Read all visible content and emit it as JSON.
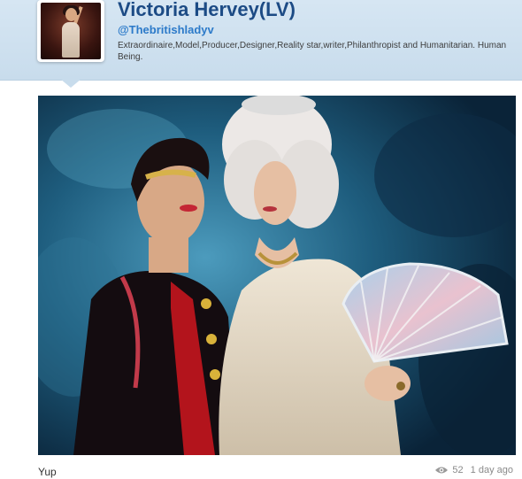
{
  "profile": {
    "name": "Victoria Hervey(LV)",
    "handle": "@Thebritishladyv",
    "bio": "Extraordinaire,Model,Producer,Designer,Reality star,writer,Philanthropist and Humanitarian. Human Being."
  },
  "post": {
    "caption": "Yup",
    "views": "52",
    "time_ago": "1 day ago"
  },
  "icons": {
    "views": "eye-icon"
  },
  "colors": {
    "header_bg": "#c8dcec",
    "name": "#1c4b85",
    "handle": "#2c7ac9"
  }
}
